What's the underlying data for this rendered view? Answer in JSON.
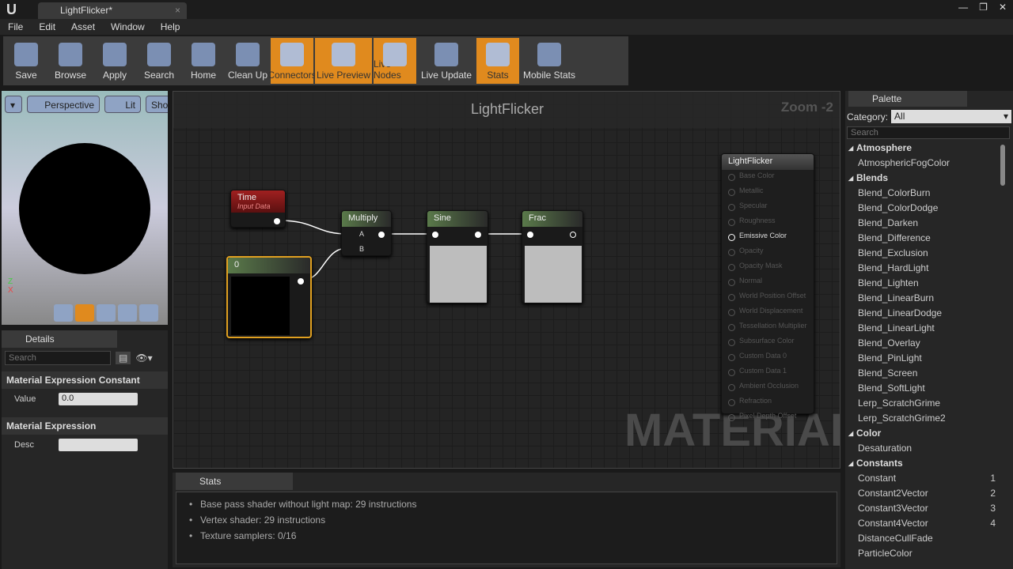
{
  "window": {
    "tab_title": "LightFlicker*"
  },
  "menu": [
    "File",
    "Edit",
    "Asset",
    "Window",
    "Help"
  ],
  "toolbar": [
    {
      "label": "Save",
      "active": false
    },
    {
      "label": "Browse",
      "active": false
    },
    {
      "label": "Apply",
      "active": false
    },
    {
      "label": "Search",
      "active": false
    },
    {
      "label": "Home",
      "active": false
    },
    {
      "label": "Clean Up",
      "active": false
    },
    {
      "label": "Connectors",
      "active": true
    },
    {
      "label": "Live Preview",
      "active": true
    },
    {
      "label": "Live Nodes",
      "active": true
    },
    {
      "label": "Live Update",
      "active": false
    },
    {
      "label": "Stats",
      "active": true
    },
    {
      "label": "Mobile Stats",
      "active": false
    }
  ],
  "viewport": {
    "perspective": "Perspective",
    "lit": "Lit",
    "show": "Sho"
  },
  "details": {
    "tab": "Details",
    "search_placeholder": "Search",
    "section1": "Material Expression Constant",
    "value_label": "Value",
    "value": "0.0",
    "section2": "Material Expression",
    "desc_label": "Desc",
    "desc": ""
  },
  "graph": {
    "title": "LightFlicker",
    "zoom": "Zoom -2",
    "watermark": "MATERIAL",
    "nodes": {
      "time_title": "Time",
      "time_sub": "Input Data",
      "const_title": "0",
      "multiply": "Multiply",
      "pin_a": "A",
      "pin_b": "B",
      "sine": "Sine",
      "frac": "Frac"
    },
    "output": {
      "title": "LightFlicker",
      "pins": [
        "Base Color",
        "Metallic",
        "Specular",
        "Roughness",
        "Emissive Color",
        "Opacity",
        "Opacity Mask",
        "Normal",
        "World Position Offset",
        "World Displacement",
        "Tessellation Multiplier",
        "Subsurface Color",
        "Custom Data 0",
        "Custom Data 1",
        "Ambient Occlusion",
        "Refraction",
        "Pixel Depth Offset"
      ],
      "active_pin": "Emissive Color"
    }
  },
  "stats": {
    "tab": "Stats",
    "lines": [
      "Base pass shader without light map: 29 instructions",
      "Vertex shader: 29 instructions",
      "Texture samplers: 0/16"
    ]
  },
  "palette": {
    "tab": "Palette",
    "category_label": "Category:",
    "category": "All",
    "search_placeholder": "Search",
    "items": [
      {
        "t": "Atmosphere",
        "cat": true
      },
      {
        "t": "AtmosphericFogColor"
      },
      {
        "t": "Blends",
        "cat": true
      },
      {
        "t": "Blend_ColorBurn"
      },
      {
        "t": "Blend_ColorDodge"
      },
      {
        "t": "Blend_Darken"
      },
      {
        "t": "Blend_Difference"
      },
      {
        "t": "Blend_Exclusion"
      },
      {
        "t": "Blend_HardLight"
      },
      {
        "t": "Blend_Lighten"
      },
      {
        "t": "Blend_LinearBurn"
      },
      {
        "t": "Blend_LinearDodge"
      },
      {
        "t": "Blend_LinearLight"
      },
      {
        "t": "Blend_Overlay"
      },
      {
        "t": "Blend_PinLight"
      },
      {
        "t": "Blend_Screen"
      },
      {
        "t": "Blend_SoftLight"
      },
      {
        "t": "Lerp_ScratchGrime"
      },
      {
        "t": "Lerp_ScratchGrime2"
      },
      {
        "t": "Color",
        "cat": true
      },
      {
        "t": "Desaturation"
      },
      {
        "t": "Constants",
        "cat": true
      },
      {
        "t": "Constant",
        "k": "1"
      },
      {
        "t": "Constant2Vector",
        "k": "2"
      },
      {
        "t": "Constant3Vector",
        "k": "3"
      },
      {
        "t": "Constant4Vector",
        "k": "4"
      },
      {
        "t": "DistanceCullFade"
      },
      {
        "t": "ParticleColor"
      }
    ]
  }
}
